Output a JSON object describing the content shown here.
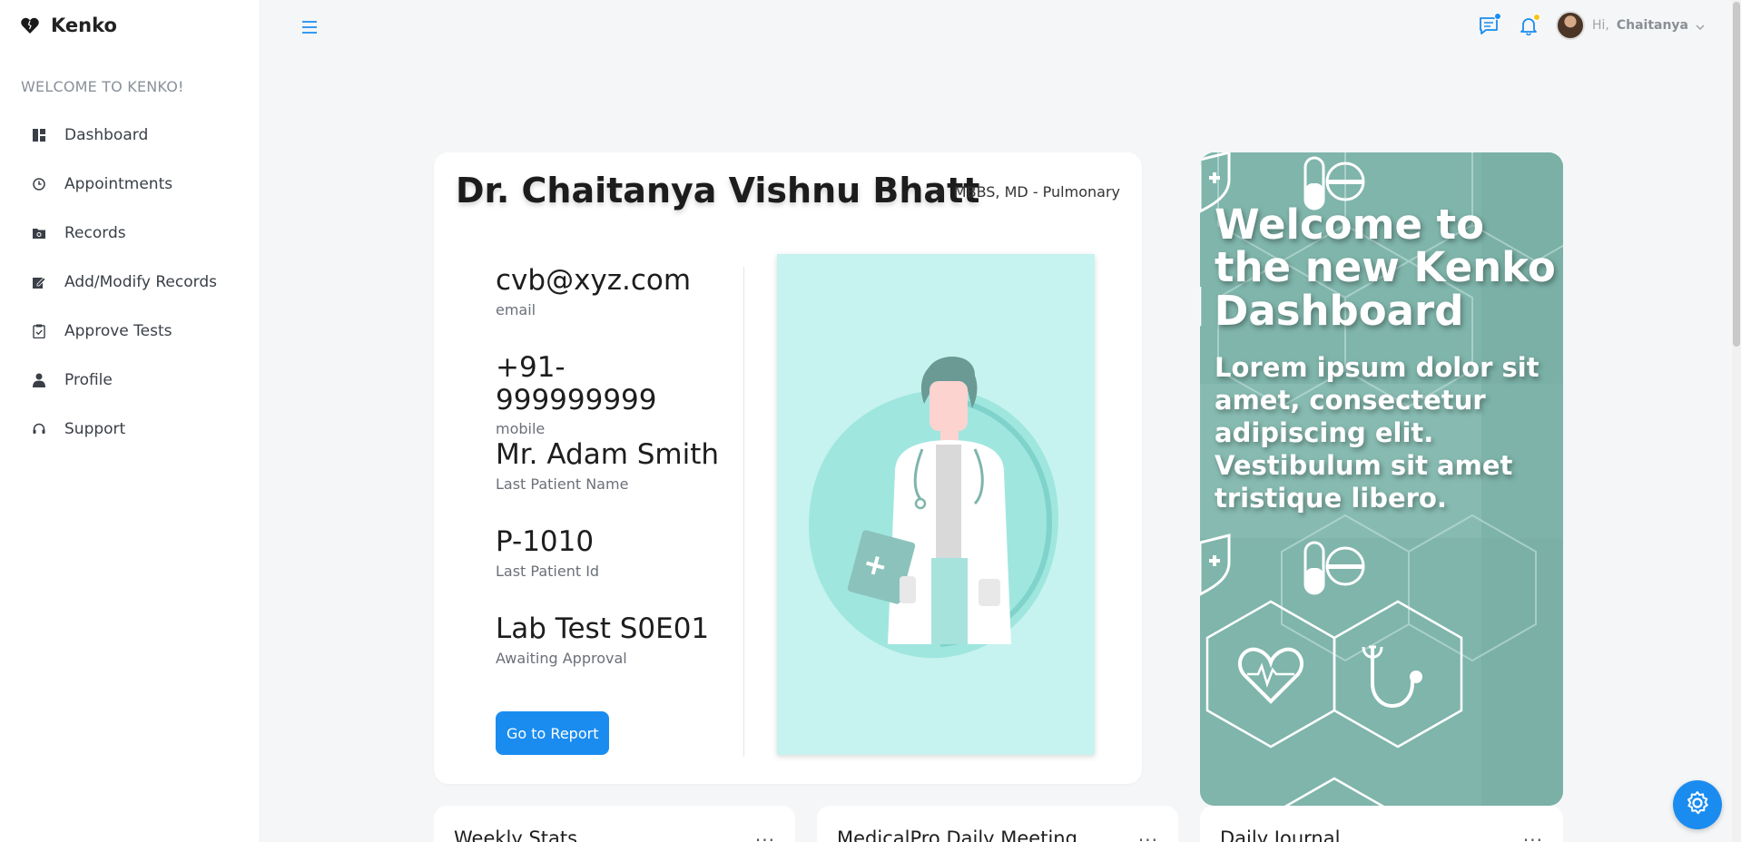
{
  "brand": {
    "name": "Kenko",
    "icon": "heart-icon"
  },
  "sidebar": {
    "welcome": "WELCOME TO KENKO!",
    "items": [
      {
        "label": "Dashboard",
        "icon": "dashboard-icon"
      },
      {
        "label": "Appointments",
        "icon": "clock-icon"
      },
      {
        "label": "Records",
        "icon": "folder-icon"
      },
      {
        "label": "Add/Modify Records",
        "icon": "edit-icon"
      },
      {
        "label": "Approve Tests",
        "icon": "clipboard-check-icon"
      },
      {
        "label": "Profile",
        "icon": "user-icon"
      },
      {
        "label": "Support",
        "icon": "headset-icon"
      }
    ]
  },
  "topbar": {
    "greeting": "Hi,",
    "user_name": "Chaitanya",
    "chat_dot_color": "#1a8cf0",
    "bell_dot_color": "#f5c518"
  },
  "profile": {
    "name": "Dr. Chaitanya Vishnu Bhatt",
    "degree": "MBBS, MD - Pulmonary",
    "fields": [
      {
        "value": "cvb@xyz.com",
        "label": "email"
      },
      {
        "value": "+91-999999999",
        "label": "mobile"
      },
      {
        "value": "Mr. Adam Smith",
        "label": "Last Patient Name"
      },
      {
        "value": "P-1010",
        "label": "Last Patient Id"
      },
      {
        "value": "Lab Test S0E01",
        "label": "Awaiting Approval"
      }
    ],
    "button_label": "Go to Report"
  },
  "banner": {
    "title": "Welcome to the new Kenko Dashboard",
    "text": "Lorem ipsum dolor sit amet, consectetur adipiscing elit. Vestibulum sit amet tristique libero."
  },
  "cards": [
    {
      "title": "Weekly Stats",
      "more": "..."
    },
    {
      "title": "MedicalPro Daily Meeting",
      "more": "..."
    },
    {
      "title": "Daily Journal",
      "more": "..."
    }
  ],
  "colors": {
    "accent": "#1a8cf0",
    "banner": "#7fb5ab",
    "illustration_bg": "#c6f3ef"
  }
}
